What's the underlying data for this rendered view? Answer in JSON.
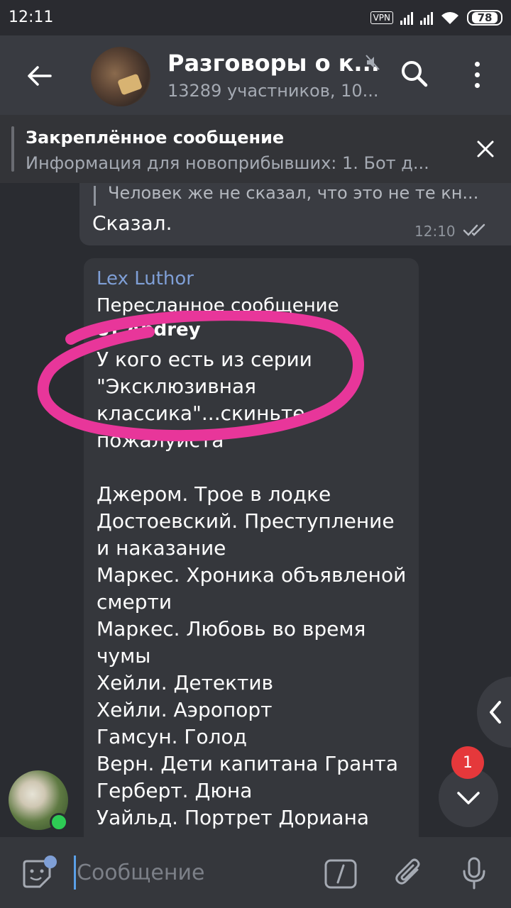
{
  "status_bar": {
    "time": "12:11",
    "vpn": "VPN",
    "battery": "78"
  },
  "header": {
    "title": "Разговоры о к...",
    "subtitle": "13289 участников, 10..."
  },
  "pinned": {
    "title": "Закреплённое сообщение",
    "text": "Информация для новоприбывших:  1. Бот д..."
  },
  "messages": {
    "outgoing": {
      "reply_preview": "Человек же не сказал, что это не те кн...",
      "text": "Сказал.",
      "time": "12:10"
    },
    "incoming": {
      "sender": "Lex Luthor",
      "forwarded_label": "Пересланное сообщение",
      "forwarded_from": "от Andrey",
      "text": "У кого есть из серии \"Эксклюзивная классика\"...скиньте пожалуйста\n\nДжером. Трое в лодке\nДостоевский. Преступление и наказание\nМаркес. Хроника объявленой смерти\nМаркес. Любовь во время чумы\nХейли. Детектив\nХейли. Аэропорт\nГамсун. Голод\nВерн. Дети капитана Гранта\nГерберт. Дюна\nУайльд. Портрет Дориана"
    }
  },
  "unread_badge": "1",
  "input": {
    "placeholder": "Сообщение"
  },
  "colors": {
    "accent": "#7f9fd6",
    "annotation": "#e8369a",
    "badge": "#e5383b",
    "online": "#2ecb55"
  }
}
